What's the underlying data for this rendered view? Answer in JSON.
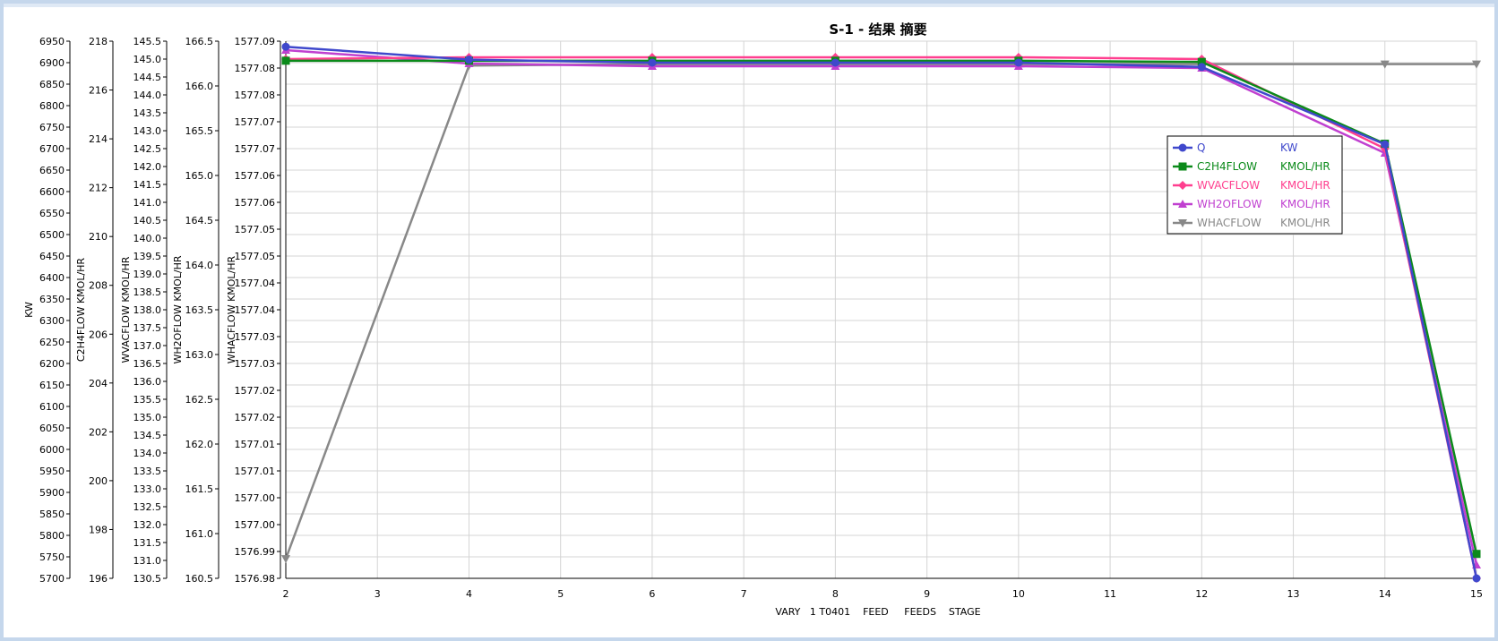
{
  "chart_data": {
    "type": "line",
    "title": "S-1 - 结果 摘要",
    "xlabel": "VARY   1 T0401    FEED     FEEDS    STAGE",
    "x": [
      2,
      4,
      6,
      8,
      10,
      12,
      14,
      15
    ],
    "x_range": [
      2,
      15
    ],
    "x_ticks": [
      "2",
      "3",
      "4",
      "5",
      "6",
      "7",
      "8",
      "9",
      "10",
      "11",
      "12",
      "13",
      "14",
      "15"
    ],
    "grid": true,
    "legend_position": "right",
    "y_axes": [
      {
        "id": "kw",
        "label": "KW",
        "range": [
          5700,
          6950
        ],
        "ticks": [
          "5700",
          "5750",
          "5800",
          "5850",
          "5900",
          "5950",
          "6000",
          "6050",
          "6100",
          "6150",
          "6200",
          "6250",
          "6300",
          "6350",
          "6400",
          "6450",
          "6500",
          "6550",
          "6600",
          "6650",
          "6700",
          "6750",
          "6800",
          "6850",
          "6900",
          "6950"
        ]
      },
      {
        "id": "c2h4",
        "label": "C2H4FLOW    KMOL/HR",
        "range": [
          196,
          218
        ],
        "ticks": [
          "196",
          "198",
          "200",
          "202",
          "204",
          "206",
          "208",
          "210",
          "212",
          "214",
          "216",
          "218"
        ]
      },
      {
        "id": "wvac",
        "label": "WVACFLOW    KMOL/HR",
        "range": [
          130.5,
          145.5
        ],
        "ticks": [
          "130.5",
          "131.0",
          "131.5",
          "132.0",
          "132.5",
          "133.0",
          "133.5",
          "134.0",
          "134.5",
          "135.0",
          "135.5",
          "136.0",
          "136.5",
          "137.0",
          "137.5",
          "138.0",
          "138.5",
          "139.0",
          "139.5",
          "140.0",
          "140.5",
          "141.0",
          "141.5",
          "142.0",
          "142.5",
          "143.0",
          "143.5",
          "144.0",
          "144.5",
          "145.0",
          "145.5"
        ]
      },
      {
        "id": "wh2o",
        "label": "WH2OFLOW    KMOL/HR",
        "range": [
          160.5,
          166.5
        ],
        "ticks": [
          "160.5",
          "161.0",
          "161.5",
          "162.0",
          "162.5",
          "163.0",
          "163.5",
          "164.0",
          "164.5",
          "165.0",
          "165.5",
          "166.0",
          "166.5"
        ]
      },
      {
        "id": "whac",
        "label": "WHACFLOW    KMOL/HR",
        "range": [
          1576.98,
          1577.09
        ],
        "ticks": [
          "1576.98",
          "1576.99",
          "1577.00",
          "1577.00",
          "1577.01",
          "1577.01",
          "1577.02",
          "1577.02",
          "1577.03",
          "1577.03",
          "1577.04",
          "1577.04",
          "1577.05",
          "1577.05",
          "1577.06",
          "1577.06",
          "1577.07",
          "1577.07",
          "1577.08",
          "1577.08",
          "1577.09"
        ]
      }
    ],
    "series": [
      {
        "name": "Q",
        "unit": "KW",
        "axis": "kw",
        "color": "#3f48cc",
        "marker": "circle",
        "values": [
          6937,
          6907,
          6900,
          6900,
          6900,
          6890,
          6710,
          5700
        ]
      },
      {
        "name": "C2H4FLOW",
        "unit": "KMOL/HR",
        "axis": "c2h4",
        "color": "#0b8a1a",
        "marker": "square",
        "values": [
          217.2,
          217.2,
          217.2,
          217.2,
          217.2,
          217.15,
          213.8,
          197.0
        ]
      },
      {
        "name": "WVACFLOW",
        "unit": "KMOL/HR",
        "axis": "wvac",
        "color": "#ff3f8f",
        "marker": "diamond",
        "values": [
          145.0,
          145.05,
          145.05,
          145.05,
          145.05,
          145.0,
          142.5,
          130.5
        ]
      },
      {
        "name": "WH2OFLOW",
        "unit": "KMOL/HR",
        "axis": "wh2o",
        "color": "#c040d0",
        "marker": "triangle-up",
        "values": [
          166.4,
          166.25,
          166.22,
          166.22,
          166.22,
          166.2,
          165.25,
          160.65
        ]
      },
      {
        "name": "WHACFLOW",
        "unit": "KMOL/HR",
        "axis": "whac",
        "color": "#888888",
        "marker": "triangle-down",
        "values": [
          1576.984,
          1577.085,
          1577.0853,
          1577.0853,
          1577.0853,
          1577.0853,
          1577.0853,
          1577.0853
        ]
      }
    ]
  }
}
